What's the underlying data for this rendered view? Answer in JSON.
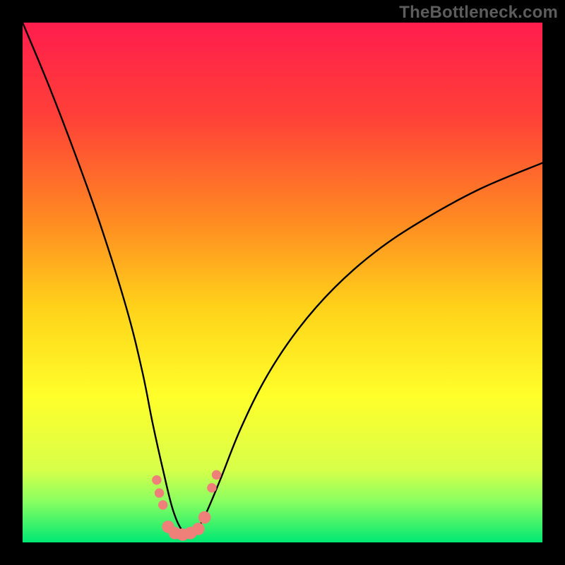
{
  "watermark": "TheBottleneck.com",
  "chart_data": {
    "type": "line",
    "title": "",
    "xlabel": "",
    "ylabel": "",
    "xlim": [
      0,
      100
    ],
    "ylim": [
      0,
      100
    ],
    "grid": false,
    "legend": false,
    "background_gradient_stops": [
      {
        "offset": 0.0,
        "color": "#ff1d4d"
      },
      {
        "offset": 0.18,
        "color": "#ff4038"
      },
      {
        "offset": 0.38,
        "color": "#ff8a22"
      },
      {
        "offset": 0.55,
        "color": "#ffd31a"
      },
      {
        "offset": 0.72,
        "color": "#ffff2a"
      },
      {
        "offset": 0.86,
        "color": "#d7ff4a"
      },
      {
        "offset": 0.92,
        "color": "#8bff60"
      },
      {
        "offset": 1.0,
        "color": "#00e874"
      }
    ],
    "series": [
      {
        "name": "bottleneck-curve",
        "stroke": "#000000",
        "x": [
          0,
          5,
          10,
          15,
          20,
          23,
          25,
          27,
          29,
          31,
          33,
          35,
          38,
          42,
          47,
          53,
          60,
          68,
          77,
          88,
          100
        ],
        "y": [
          100,
          88,
          75,
          61,
          45,
          33,
          23,
          14,
          6,
          2,
          2,
          5,
          12,
          22,
          32,
          41,
          49,
          56,
          62,
          68,
          73
        ]
      }
    ],
    "marker_series": {
      "name": "highlight-markers",
      "fill": "#ee8079",
      "points": [
        {
          "x": 25.8,
          "y": 12.0,
          "r": 1.6
        },
        {
          "x": 26.3,
          "y": 9.5,
          "r": 1.6
        },
        {
          "x": 27.0,
          "y": 7.2,
          "r": 1.6
        },
        {
          "x": 28.0,
          "y": 3.0,
          "r": 2.1
        },
        {
          "x": 29.3,
          "y": 1.8,
          "r": 2.1
        },
        {
          "x": 30.8,
          "y": 1.5,
          "r": 2.1
        },
        {
          "x": 32.3,
          "y": 1.8,
          "r": 2.1
        },
        {
          "x": 33.8,
          "y": 2.6,
          "r": 2.1
        },
        {
          "x": 35.0,
          "y": 4.8,
          "r": 2.1
        },
        {
          "x": 36.4,
          "y": 10.5,
          "r": 1.6
        },
        {
          "x": 37.3,
          "y": 13.0,
          "r": 1.6
        }
      ]
    }
  }
}
